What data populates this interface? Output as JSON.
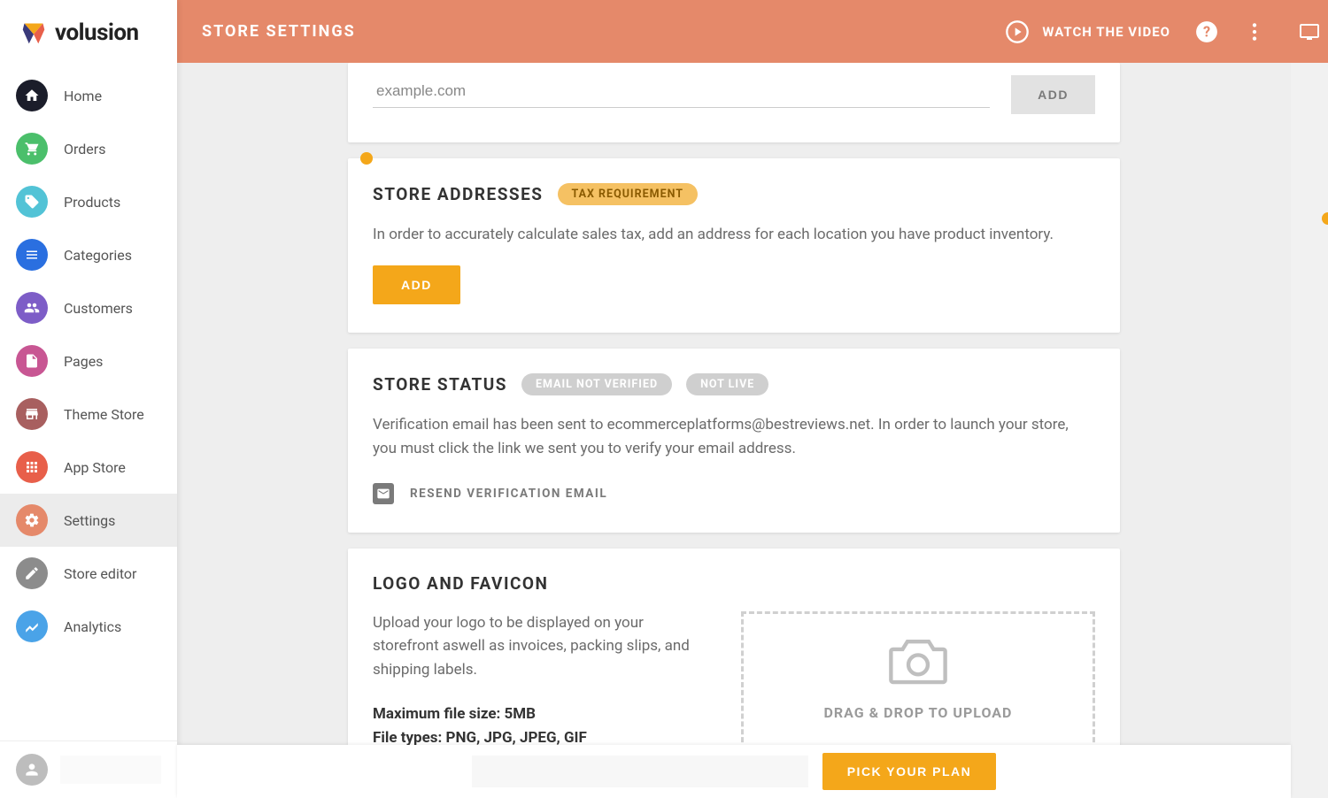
{
  "brand": {
    "name": "volusion"
  },
  "topbar": {
    "title": "STORE SETTINGS",
    "watch": "WATCH THE VIDEO"
  },
  "sidebar": {
    "items": [
      {
        "label": "Home",
        "color": "#1b1d2a",
        "icon": "home"
      },
      {
        "label": "Orders",
        "color": "#4bbf6b",
        "icon": "cart"
      },
      {
        "label": "Products",
        "color": "#52c3d6",
        "icon": "tag"
      },
      {
        "label": "Categories",
        "color": "#2a6fe0",
        "icon": "list"
      },
      {
        "label": "Customers",
        "color": "#7d5dc7",
        "icon": "people"
      },
      {
        "label": "Pages",
        "color": "#c85693",
        "icon": "page"
      },
      {
        "label": "Theme Store",
        "color": "#a85f5f",
        "icon": "store"
      },
      {
        "label": "App Store",
        "color": "#e85f4a",
        "icon": "apps"
      },
      {
        "label": "Settings",
        "color": "#e5896a",
        "icon": "gear"
      },
      {
        "label": "Store editor",
        "color": "#8c8c8c",
        "icon": "pencil"
      },
      {
        "label": "Analytics",
        "color": "#4aa3e8",
        "icon": "chart"
      }
    ],
    "activeIndex": 8
  },
  "cards": {
    "domains": {
      "placeholder": "example.com",
      "addLabel": "ADD"
    },
    "addresses": {
      "title": "STORE ADDRESSES",
      "badge": "TAX REQUIREMENT",
      "body": "In order to accurately calculate sales tax, add an address for each location you have product inventory.",
      "addLabel": "ADD"
    },
    "status": {
      "title": "STORE STATUS",
      "badge1": "EMAIL NOT VERIFIED",
      "badge2": "NOT LIVE",
      "body": "Verification email has been sent to ecommerceplatforms@bestreviews.net. In order to launch your store, you must click the link we sent you to verify your email address.",
      "resend": "RESEND VERIFICATION EMAIL"
    },
    "logo": {
      "title": "LOGO AND FAVICON",
      "desc": "Upload your logo to be displayed on your storefront aswell as invoices, packing slips, and shipping labels.",
      "maxLabel": "Maximum file size: ",
      "maxValue": "5MB",
      "typesLabel": "File types: ",
      "typesValue": "PNG, JPG, JPEG, GIF",
      "dropText": "DRAG & DROP TO UPLOAD"
    }
  },
  "footer": {
    "planLabel": "PICK YOUR PLAN"
  }
}
